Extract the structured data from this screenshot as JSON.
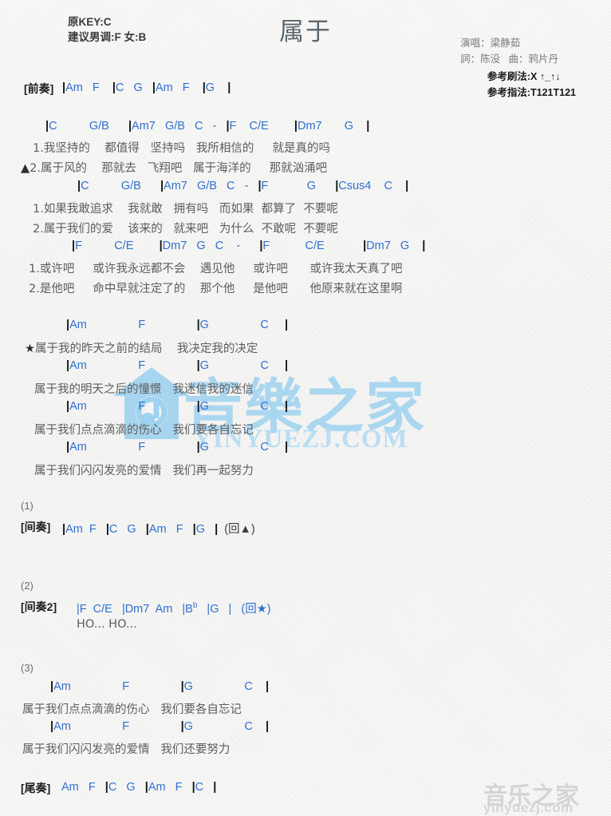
{
  "header": {
    "title": "属于",
    "key_line1": "原KEY:C",
    "key_line2": "建议男调:F 女:B",
    "singer": "演唱：梁静茹",
    "writers": "詞：陈没   曲：鸦片丹",
    "strum": "参考刷法:X ↑_↑↓",
    "fingerstyle": "参考指法:T121T121"
  },
  "watermark": {
    "main_cn": "音樂之家",
    "main_url": "YINYUEZJ.COM",
    "bottom_cn": "音乐之家",
    "bottom_url": "yinyuezj.com",
    "color": "#9ed2f0"
  },
  "sections": {
    "intro_label": "[前奏]",
    "intro_chords": "|Am   F    |C   G   |Am   F    |G    |",
    "interlude1_tag": "(1)",
    "interlude1_label": "[间奏]",
    "interlude1_chords": "|Am  F   |C   G   |Am   F   |G   |  (回▲)",
    "interlude2_tag": "(2)",
    "interlude2_label": "[间奏2]",
    "interlude2_chords_a": "|F  C/E   |Dm7  Am   |B",
    "interlude2_flat": "b",
    "interlude2_chords_b": "   |G   |   (回★)",
    "interlude2_lyric": "HO... HO...",
    "section3_tag": "(3)",
    "outro_label": "[尾奏]",
    "outro_chords": "Am   F   |C   G   |Am   F   |C   |"
  },
  "verse": {
    "line1_chords": "|C          G/B      |Am7   G/B   C   -   |F    C/E        |Dm7       G    |",
    "line1_lyric_a": "1.我坚持的    都值得   坚持吗   我所相信的     就是真的吗",
    "line1_lyric_b_mark": "▲",
    "line1_lyric_b": "2.属于风的    那就去   飞翔吧   属于海洋的     那就汹涌吧",
    "line2_chords": "|C          G/B      |Am7   G/B   C   -   |F            G      |Csus4    C    |",
    "line2_lyric_a": "1.如果我敢追求    我就敢   拥有吗   而如果  都算了  不要呢",
    "line2_lyric_b": "2.属于我们的爱    该来的   就来吧   为什么  不敢呢  不要呢",
    "line3_chords": "|F          C/E        |Dm7   G   C    -      |F           C/E            |Dm7   G    |",
    "line3_lyric_a": "1.或许吧     或许我永远都不会    遇见他     或许吧      或许我太天真了吧",
    "line3_lyric_b": "2.是他吧     命中早就注定了的    那个他     是他吧      他原来就在这里啊"
  },
  "chorus": {
    "chords": "|Am                F                |G                C     |",
    "line1_mark": "★",
    "line1": "属于我的昨天之前的结局    我决定我的决定",
    "line2": "属于我的明天之后的憧憬   我迷信我的迷信",
    "line3": "属于我们点点滴滴的伤心   我们要各自忘记",
    "line4": "属于我们闪闪发亮的爱情   我们再一起努力"
  },
  "section3": {
    "chords": "|Am                F                |G                C    |",
    "line1": "属于我们点点滴滴的伤心   我们要各自忘记",
    "line2": "属于我们闪闪发亮的爱情   我们还要努力"
  }
}
